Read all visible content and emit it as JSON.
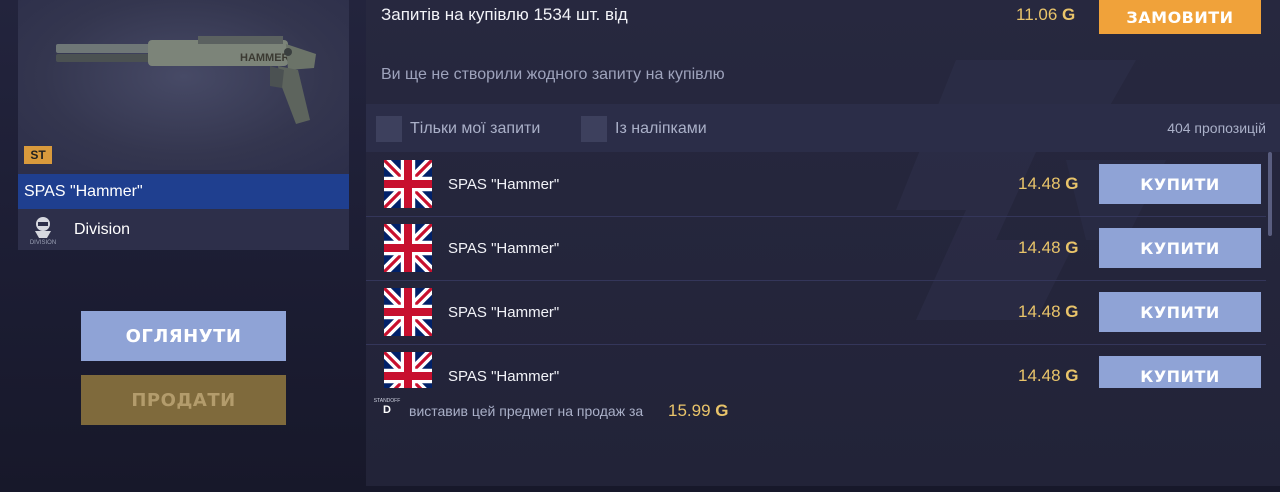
{
  "item": {
    "name": "SPAS \"Hammer\"",
    "rarity_badge": "ST",
    "owner_logo_label": "DIVISION",
    "owner_name": "Division",
    "inspect_label": "ОГЛЯНУТИ",
    "sell_label": "ПРОДАТИ"
  },
  "orders": {
    "summary": "Запитів на купівлю 1534 шт. від",
    "price": "11.06",
    "currency_symbol": "G",
    "order_button": "ЗАМОВИТИ",
    "empty_message": "Ви ще не створили жодного запиту на купівлю"
  },
  "filters": {
    "my_requests_label": "Тільки мої запити",
    "with_stickers_label": "Із наліпками",
    "offers_count": "404 пропозицій"
  },
  "listings": [
    {
      "name": "SPAS \"Hammer\"",
      "price": "14.48",
      "currency": "G",
      "button": "КУПИТИ",
      "flag": "uk-flag-icon"
    },
    {
      "name": "SPAS \"Hammer\"",
      "price": "14.48",
      "currency": "G",
      "button": "КУПИТИ",
      "flag": "uk-flag-icon"
    },
    {
      "name": "SPAS \"Hammer\"",
      "price": "14.48",
      "currency": "G",
      "button": "КУПИТИ",
      "flag": "uk-flag-icon"
    },
    {
      "name": "SPAS \"Hammer\"",
      "price": "14.48",
      "currency": "G",
      "button": "КУПИТИ",
      "flag": "uk-flag-icon"
    }
  ],
  "seller": {
    "logo_letter": "D",
    "logo_small_text": "STANDOFF",
    "text": "виставив цей предмет на продаж за",
    "price": "15.99",
    "currency": "G"
  },
  "colors": {
    "accent_order": "#f0a23a",
    "buy_button": "#8fa3d6",
    "price_gold": "#e9c46a",
    "selected_bar": "#1f3f8f"
  }
}
